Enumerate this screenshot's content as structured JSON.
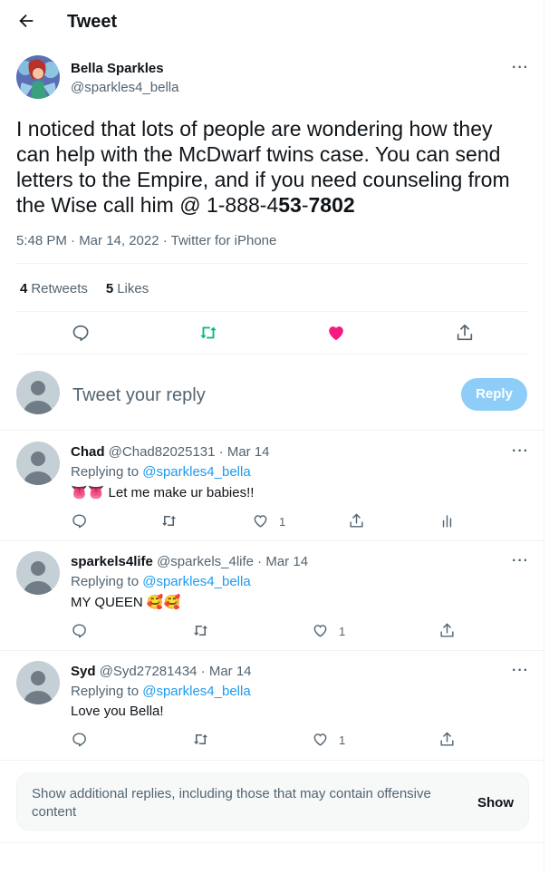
{
  "header": {
    "title": "Tweet"
  },
  "tweet": {
    "author_name": "Bella Sparkles",
    "author_handle": "@sparkles4_bella",
    "text_plain": "I noticed that lots of people are wondering how they can help with the McDwarf twins case. You can send letters to the Empire, and if you need counseling from the Wise call him @ 1-888-4",
    "text_bold_a": "53",
    "text_sep": "-",
    "text_bold_b": "7802",
    "timestamp": "5:48 PM · Mar 14, 2022 · Twitter for iPhone",
    "retweets_count": "4",
    "retweets_label": "Retweets",
    "likes_count": "5",
    "likes_label": "Likes"
  },
  "compose": {
    "placeholder": "Tweet your reply",
    "button_label": "Reply"
  },
  "replying_to_label": "Replying to",
  "replies": [
    {
      "name": "Chad",
      "handle_date": "@Chad82025131 · Mar 14",
      "replying_to": "@sparkles4_bella",
      "emoji": "👅👅",
      "text": "Let me make ur babies!!",
      "likes": "1"
    },
    {
      "name": "sparkels4life",
      "handle_date": "@sparkels_4life · Mar 14",
      "replying_to": "@sparkles4_bella",
      "text": "MY QUEEN",
      "emoji": "🥰🥰",
      "likes": "1"
    },
    {
      "name": "Syd",
      "handle_date": "@Syd27281434 · Mar 14",
      "replying_to": "@sparkles4_bella",
      "text": "Love you Bella!",
      "likes": "1"
    }
  ],
  "more_replies": {
    "text": "Show additional replies, including those that may contain offensive content",
    "button_label": "Show"
  },
  "colors": {
    "accent": "#1d9bf0",
    "retweet": "#00ba7c",
    "like": "#f91880",
    "reply_button": "#8ecdf8"
  },
  "icons": [
    "back-arrow-icon",
    "more-icon",
    "reply-icon",
    "retweet-icon",
    "heart-icon",
    "share-icon",
    "analytics-icon"
  ]
}
